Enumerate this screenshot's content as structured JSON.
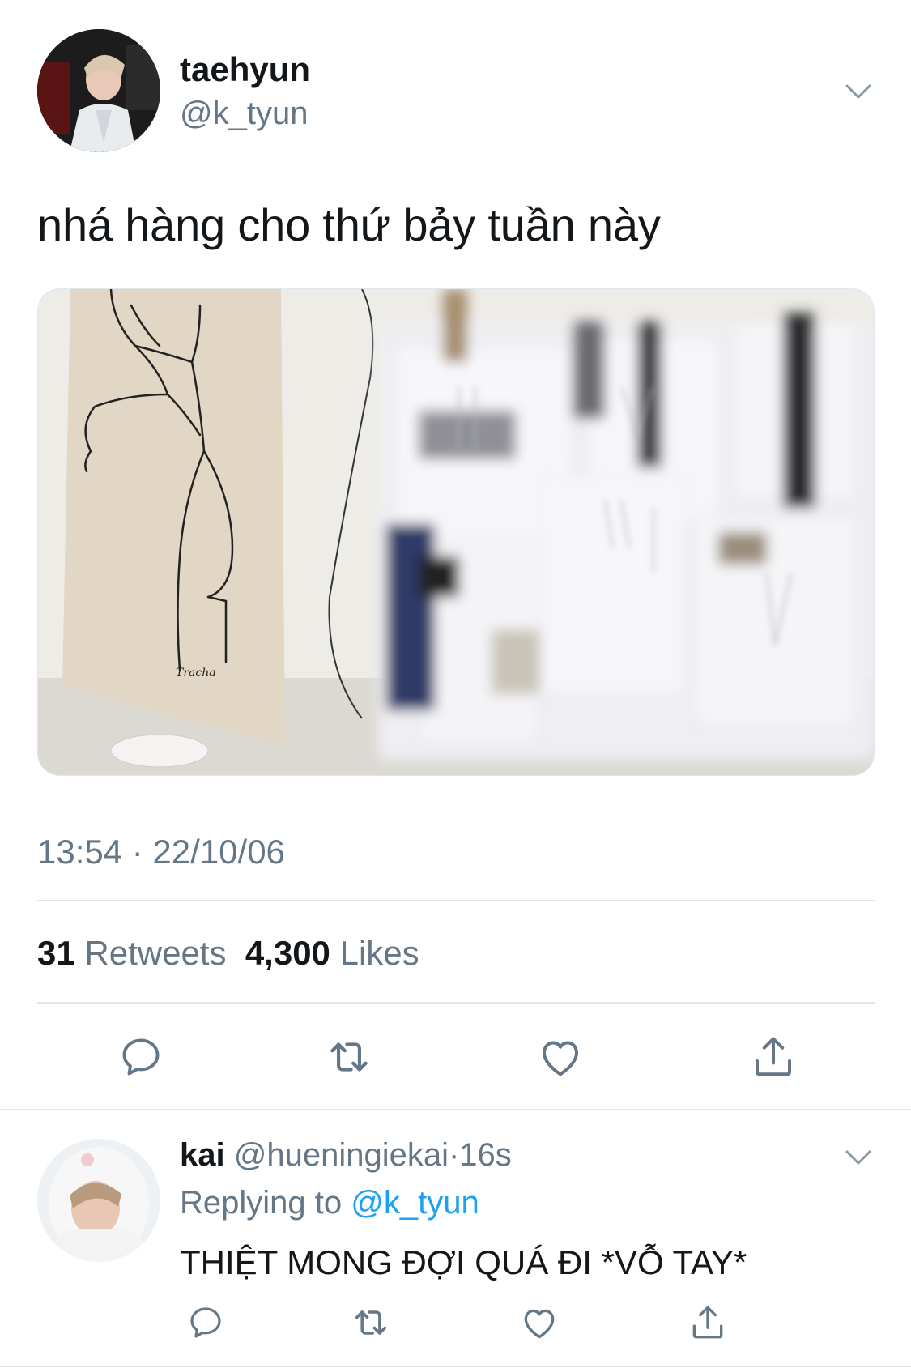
{
  "tweet": {
    "display_name": "taehyun",
    "handle": "@k_tyun",
    "text": "nhá hàng cho thứ bảy tuần này",
    "timestamp": "13:54 · 22/10/06",
    "retweets_count": "31",
    "retweets_label": "Retweets",
    "likes_count": "4,300",
    "likes_label": "Likes"
  },
  "reply": {
    "display_name": "kai",
    "handle": "@hueningiekai",
    "separator": "·",
    "age": "16s",
    "replying_label": "Replying to",
    "replying_handle": "@k_tyun",
    "text": "THIỆT MONG ĐỢI QUÁ ĐI *VỖ TAY*"
  },
  "icons": {
    "reply": "reply-icon",
    "retweet": "retweet-icon",
    "like": "heart-icon",
    "share": "share-icon",
    "more": "chevron-down-icon"
  },
  "colors": {
    "text": "#14171a",
    "secondary": "#657786",
    "link": "#1da1f2",
    "divider": "#e1e8ed"
  }
}
